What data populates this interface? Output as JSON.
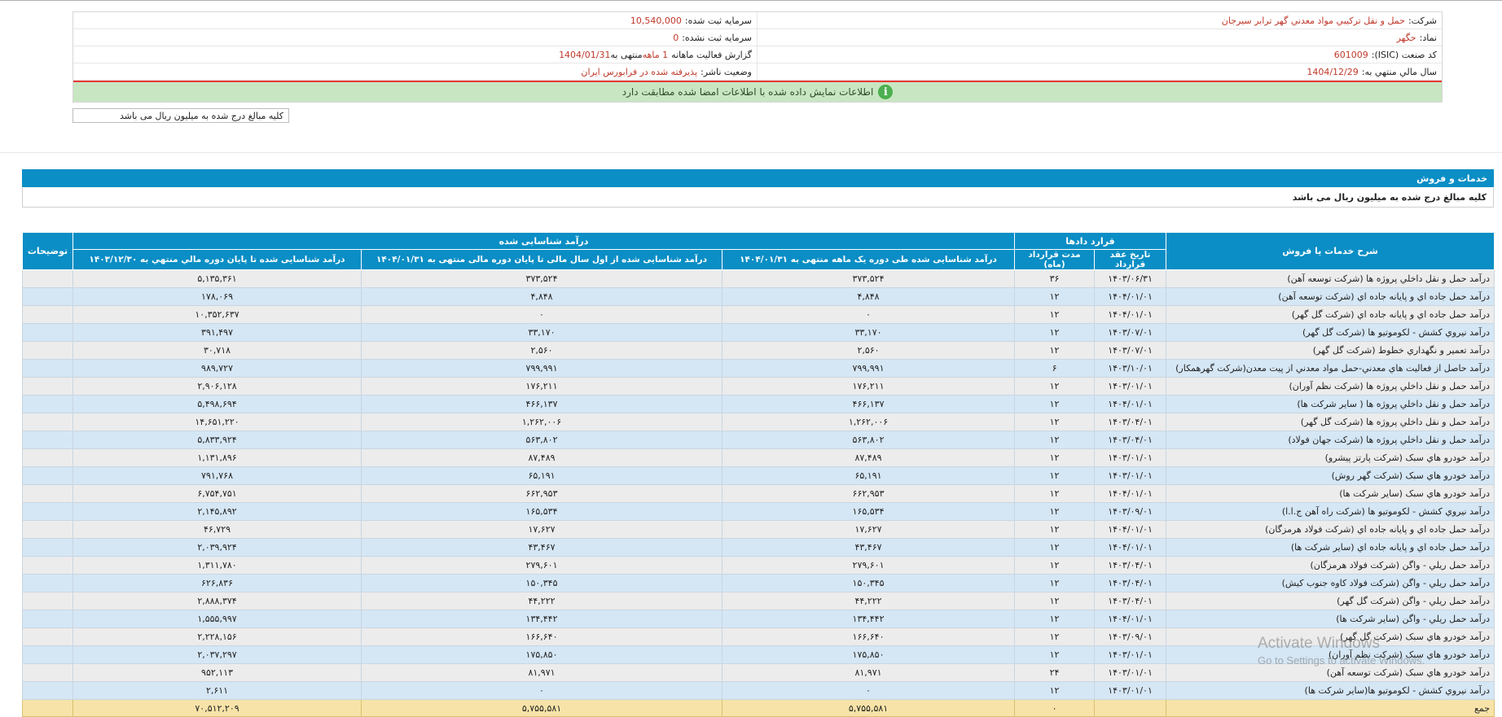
{
  "company_info": {
    "company_label": "شرکت:",
    "company_value": "حمل و نقل ترکيبي مواد معدني گهر ترابر سيرجان",
    "capital_label": "سرمايه ثبت شده:",
    "capital_value": "10,540,000",
    "symbol_label": "نماد:",
    "symbol_value": "حگهر",
    "unregistered_capital_label": "سرمايه ثبت نشده:",
    "unregistered_capital_value": "0",
    "isic_label": "کد صنعت (ISIC):",
    "isic_value": "601009",
    "report_label": "گزارش فعاليت ماهانه",
    "report_period": "1 ماهه",
    "report_ending_text": "منتهی به",
    "report_date": "1404/01/31",
    "fiscal_year_label": "سال مالي منتهي به:",
    "fiscal_year_value": "1404/12/29",
    "publisher_status_label": "وضعيت ناشر:",
    "publisher_status_value": "پذيرفته شده در فرابورس ايران"
  },
  "notice": {
    "text": "اطلاعات نمایش داده شده با اطلاعات امضا شده مطابقت دارد",
    "icon": "info-icon",
    "color": "#c8e6c1"
  },
  "units_note": "کلیه مبالغ درج شده به میلیون ریال می باشد",
  "section": {
    "title": "خدمات و فروش",
    "units_note": "کلیه مبالغ درج شده به میلیون ریال می باشد"
  },
  "table": {
    "headers": {
      "service": "شرح خدمات یا فروش",
      "contracts_group": "قرارد دادها",
      "contract_date": "تاریخ عقد قرارداد",
      "contract_duration": "مدت قرارداد (ماه)",
      "revenue_group": "درآمد شناسایی شده",
      "revenue_month": "درآمد شناسایی شده طی دوره یک ماهه منتهی به ۱۴۰۴/۰۱/۳۱",
      "revenue_ytd": "درآمد شناسایی شده از اول سال مالی تا پایان دوره مالی منتهی به ۱۴۰۴/۰۱/۳۱",
      "revenue_prev_year": "درآمد شناسایی شده تا پایان دوره مالي منتهي به ۱۴۰۳/۱۲/۳۰",
      "notes": "توضیحات"
    },
    "rows": [
      {
        "desc": "درآمد حمل و نقل داخلي پروژه ها (شرکت توسعه آهن)",
        "date": "۱۴۰۳/۰۶/۳۱",
        "duration": "۳۶",
        "month": "۳۷۳,۵۲۴",
        "ytd": "۳۷۳,۵۲۴",
        "prev": "۵,۱۳۵,۳۶۱",
        "note": ""
      },
      {
        "desc": "درآمد حمل جاده اي و پايانه جاده اي (شرکت توسعه آهن)",
        "date": "۱۴۰۴/۰۱/۰۱",
        "duration": "۱۲",
        "month": "۴,۸۴۸",
        "ytd": "۴,۸۴۸",
        "prev": "۱۷۸,۰۶۹",
        "note": ""
      },
      {
        "desc": "درآمد حمل جاده اي و پايانه جاده اي (شرکت گل گهر)",
        "date": "۱۴۰۴/۰۱/۰۱",
        "duration": "۱۲",
        "month": "۰",
        "ytd": "۰",
        "prev": "۱۰,۳۵۲,۶۳۷",
        "note": ""
      },
      {
        "desc": "درآمد نيروي کشش - لکوموتيو ها (شرکت گل گهر)",
        "date": "۱۴۰۳/۰۷/۰۱",
        "duration": "۱۲",
        "month": "۳۳,۱۷۰",
        "ytd": "۳۳,۱۷۰",
        "prev": "۳۹۱,۴۹۷",
        "note": ""
      },
      {
        "desc": "درآمد تعمير و نگهداري خطوط (شرکت گل گهر)",
        "date": "۱۴۰۳/۰۷/۰۱",
        "duration": "۱۲",
        "month": "۲,۵۶۰",
        "ytd": "۲,۵۶۰",
        "prev": "۳۰,۷۱۸",
        "note": ""
      },
      {
        "desc": "درآمد حاصل از فعاليت هاي معدني-حمل مواد معدني از پيت معدن(شرکت گهرهمکار)",
        "date": "۱۴۰۳/۱۰/۰۱",
        "duration": "۶",
        "month": "۷۹۹,۹۹۱",
        "ytd": "۷۹۹,۹۹۱",
        "prev": "۹۸۹,۷۲۷",
        "note": ""
      },
      {
        "desc": "درآمد حمل و نقل داخلي پروژه ها (شرکت نظم آوران)",
        "date": "۱۴۰۳/۰۱/۰۱",
        "duration": "۱۲",
        "month": "۱۷۶,۲۱۱",
        "ytd": "۱۷۶,۲۱۱",
        "prev": "۲,۹۰۶,۱۲۸",
        "note": ""
      },
      {
        "desc": "درآمد حمل و نقل داخلي پروژه ها ( ساير شرکت ها)",
        "date": "۱۴۰۴/۰۱/۰۱",
        "duration": "۱۲",
        "month": "۴۶۶,۱۳۷",
        "ytd": "۴۶۶,۱۳۷",
        "prev": "۵,۴۹۸,۶۹۴",
        "note": ""
      },
      {
        "desc": "درآمد حمل و نقل داخلي پروژه ها (شرکت گل گهر)",
        "date": "۱۴۰۳/۰۴/۰۱",
        "duration": "۱۲",
        "month": "۱,۲۶۲,۰۰۶",
        "ytd": "۱,۲۶۲,۰۰۶",
        "prev": "۱۴,۶۵۱,۲۲۰",
        "note": ""
      },
      {
        "desc": "درآمد حمل و نقل داخلي پروژه ها (شرکت جهان فولاد)",
        "date": "۱۴۰۳/۰۴/۰۱",
        "duration": "۱۲",
        "month": "۵۶۳,۸۰۲",
        "ytd": "۵۶۳,۸۰۲",
        "prev": "۵,۸۳۳,۹۲۴",
        "note": ""
      },
      {
        "desc": "درآمد خودرو هاي سبک (شرکت پارتز پيشرو)",
        "date": "۱۴۰۳/۰۱/۰۱",
        "duration": "۱۲",
        "month": "۸۷,۴۸۹",
        "ytd": "۸۷,۴۸۹",
        "prev": "۱,۱۳۱,۸۹۶",
        "note": ""
      },
      {
        "desc": "درآمد خودرو هاي سبک (شرکت گهر روش)",
        "date": "۱۴۰۳/۰۱/۰۱",
        "duration": "۱۲",
        "month": "۶۵,۱۹۱",
        "ytd": "۶۵,۱۹۱",
        "prev": "۷۹۱,۷۶۸",
        "note": ""
      },
      {
        "desc": "درآمد خودرو هاي سبک (ساير شرکت ها)",
        "date": "۱۴۰۴/۰۱/۰۱",
        "duration": "۱۲",
        "month": "۶۶۲,۹۵۳",
        "ytd": "۶۶۲,۹۵۳",
        "prev": "۶,۷۵۴,۷۵۱",
        "note": ""
      },
      {
        "desc": "درآمد نيروي کشش - لکوموتيو ها (شرکت راه آهن ج.ا.ا)",
        "date": "۱۴۰۳/۰۹/۰۱",
        "duration": "۱۲",
        "month": "۱۶۵,۵۳۴",
        "ytd": "۱۶۵,۵۳۴",
        "prev": "۲,۱۴۵,۸۹۲",
        "note": ""
      },
      {
        "desc": "درآمد حمل جاده اي و پايانه جاده اي (شرکت فولاد هرمزگان)",
        "date": "۱۴۰۴/۰۱/۰۱",
        "duration": "۱۲",
        "month": "۱۷,۶۲۷",
        "ytd": "۱۷,۶۲۷",
        "prev": "۴۶,۷۲۹",
        "note": ""
      },
      {
        "desc": "درآمد حمل جاده اي و پايانه جاده اي (ساير شرکت ها)",
        "date": "۱۴۰۴/۰۱/۰۱",
        "duration": "۱۲",
        "month": "۴۳,۴۶۷",
        "ytd": "۴۳,۴۶۷",
        "prev": "۲,۰۳۹,۹۲۴",
        "note": ""
      },
      {
        "desc": "درآمد حمل ريلي - واگن (شرکت فولاد هرمزگان)",
        "date": "۱۴۰۳/۰۴/۰۱",
        "duration": "۱۲",
        "month": "۲۷۹,۶۰۱",
        "ytd": "۲۷۹,۶۰۱",
        "prev": "۱,۳۱۱,۷۸۰",
        "note": ""
      },
      {
        "desc": "درآمد حمل ريلي - واگن (شرکت فولاد کاوه جنوب کيش)",
        "date": "۱۴۰۳/۰۴/۰۱",
        "duration": "۱۲",
        "month": "۱۵۰,۳۴۵",
        "ytd": "۱۵۰,۳۴۵",
        "prev": "۶۲۶,۸۳۶",
        "note": ""
      },
      {
        "desc": "درآمد حمل ريلي - واگن (شرکت گل گهر)",
        "date": "۱۴۰۳/۰۴/۰۱",
        "duration": "۱۲",
        "month": "۴۴,۲۲۲",
        "ytd": "۴۴,۲۲۲",
        "prev": "۲,۸۸۸,۳۷۴",
        "note": ""
      },
      {
        "desc": "درآمد حمل ريلي - واگن (ساير شرکت ها)",
        "date": "۱۴۰۴/۰۱/۰۱",
        "duration": "۱۲",
        "month": "۱۳۴,۴۴۲",
        "ytd": "۱۳۴,۴۴۲",
        "prev": "۱,۵۵۵,۹۹۷",
        "note": ""
      },
      {
        "desc": "درآمد خودرو هاي سبک (شرکت گل گهر)",
        "date": "۱۴۰۳/۰۹/۰۱",
        "duration": "۱۲",
        "month": "۱۶۶,۶۴۰",
        "ytd": "۱۶۶,۶۴۰",
        "prev": "۲,۲۲۸,۱۵۶",
        "note": ""
      },
      {
        "desc": "درآمد خودرو هاي سبک (شرکت نظم آوران)",
        "date": "۱۴۰۳/۰۱/۰۱",
        "duration": "۱۲",
        "month": "۱۷۵,۸۵۰",
        "ytd": "۱۷۵,۸۵۰",
        "prev": "۲,۰۳۷,۲۹۷",
        "note": ""
      },
      {
        "desc": "درآمد خودرو هاي سبک (شرکت توسعه آهن)",
        "date": "۱۴۰۳/۰۱/۰۱",
        "duration": "۲۴",
        "month": "۸۱,۹۷۱",
        "ytd": "۸۱,۹۷۱",
        "prev": "۹۵۲,۱۱۳",
        "note": ""
      },
      {
        "desc": "درآمد نيروي کشش - لکوموتيو ها(ساير شرکت ها)",
        "date": "۱۴۰۳/۰۱/۰۱",
        "duration": "۱۲",
        "month": "۰",
        "ytd": "۰",
        "prev": "۲,۶۱۱",
        "note": ""
      }
    ],
    "total": {
      "label": "جمع",
      "duration": "۰",
      "month": "۵,۷۵۵,۵۸۱",
      "ytd": "۵,۷۵۵,۵۸۱",
      "prev": "۷۰,۵۱۲,۲۰۹"
    }
  },
  "watermark": {
    "line1": "Activate Windows",
    "line2": "Go to Settings to activate Windows."
  }
}
